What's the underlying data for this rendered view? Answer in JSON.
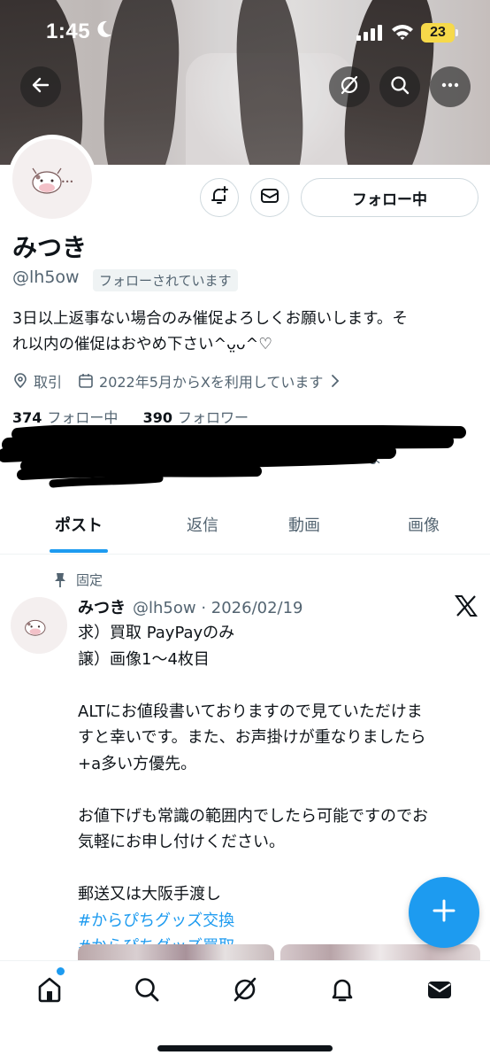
{
  "status_bar": {
    "time": "1:45",
    "battery": "23",
    "battery_color": "#f6d94a"
  },
  "top_actions": {
    "back_icon": "arrow-left-icon",
    "grok_icon": "grok-icon",
    "search_icon": "search-icon",
    "more_icon": "more-icon"
  },
  "profile": {
    "name": "みつき",
    "handle": "@lh5ow",
    "follows_you_badge": "フォローされています",
    "follow_button_label": "フォロー中",
    "bio_line1": "3日以上返事ない場合のみ催促よろしくお願いします。そ",
    "bio_line2": "れ以内の催促はおやめ下さい^ᴗ̤ᴗ^♡",
    "location": "取引",
    "joined": "2022年5月からXを利用しています",
    "following_count": "374",
    "following_label": "フォロー中",
    "followers_count": "390",
    "followers_label": "フォロワー",
    "followed_by_partial": "されていま"
  },
  "tabs": [
    {
      "label": "ポスト",
      "active": true
    },
    {
      "label": "返信",
      "active": false
    },
    {
      "label": "動画",
      "active": false
    },
    {
      "label": "画像",
      "active": false
    }
  ],
  "pinned_post": {
    "pinned_label": "固定",
    "author_name": "みつき",
    "author_meta": "@lh5ow · 2026/02/19",
    "lines": [
      "求）買取 PayPayのみ",
      "譲）画像1〜4枚目",
      "",
      "ALTにお値段書いておりますので見ていただけま",
      "すと幸いです。また、お声掛けが重なりましたら",
      "+a多い方優先。",
      "",
      "お値下げも常識の範囲内でしたら可能ですのでお",
      "気軽にお申し付けください。",
      "",
      "郵送又は大阪手渡し"
    ],
    "hashtags": [
      "#からぴちグッズ交換",
      "#からぴちグッズ買取"
    ]
  },
  "colors": {
    "accent": "#1d9bf0",
    "text_primary": "#0f1419",
    "text_secondary": "#536471",
    "border": "#cfd9de"
  },
  "bottom_nav": [
    {
      "icon": "home-icon",
      "active": true,
      "has_dot": true
    },
    {
      "icon": "search-icon"
    },
    {
      "icon": "grok-icon"
    },
    {
      "icon": "bell-icon"
    },
    {
      "icon": "mail-icon"
    }
  ]
}
